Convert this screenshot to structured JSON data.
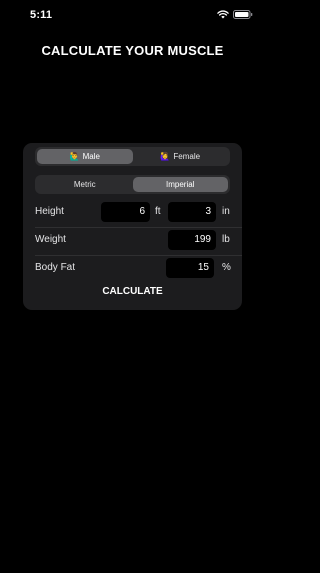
{
  "status_bar": {
    "time": "5:11"
  },
  "header": {
    "title": "CALCULATE YOUR MUSCLE"
  },
  "gender": {
    "options": [
      {
        "emoji": "🙋‍♂️",
        "label": "Male",
        "selected": true
      },
      {
        "emoji": "🙋‍♀️",
        "label": "Female",
        "selected": false
      }
    ]
  },
  "units": {
    "options": [
      {
        "label": "Metric",
        "selected": false
      },
      {
        "label": "Imperial",
        "selected": true
      }
    ]
  },
  "height": {
    "label": "Height",
    "feet_value": "6",
    "feet_unit": "ft",
    "inches_value": "3",
    "inches_unit": "in"
  },
  "weight": {
    "label": "Weight",
    "value": "199",
    "unit": "lb"
  },
  "body_fat": {
    "label": "Body Fat",
    "value": "15",
    "unit": "%"
  },
  "actions": {
    "calculate_label": "CALCULATE"
  },
  "icons": {
    "wifi": "wifi-icon",
    "battery": "battery-icon"
  },
  "colors": {
    "background": "#000000",
    "card": "#1c1c1e",
    "segment_bg": "#2c2c2e",
    "segment_active": "#636366"
  }
}
